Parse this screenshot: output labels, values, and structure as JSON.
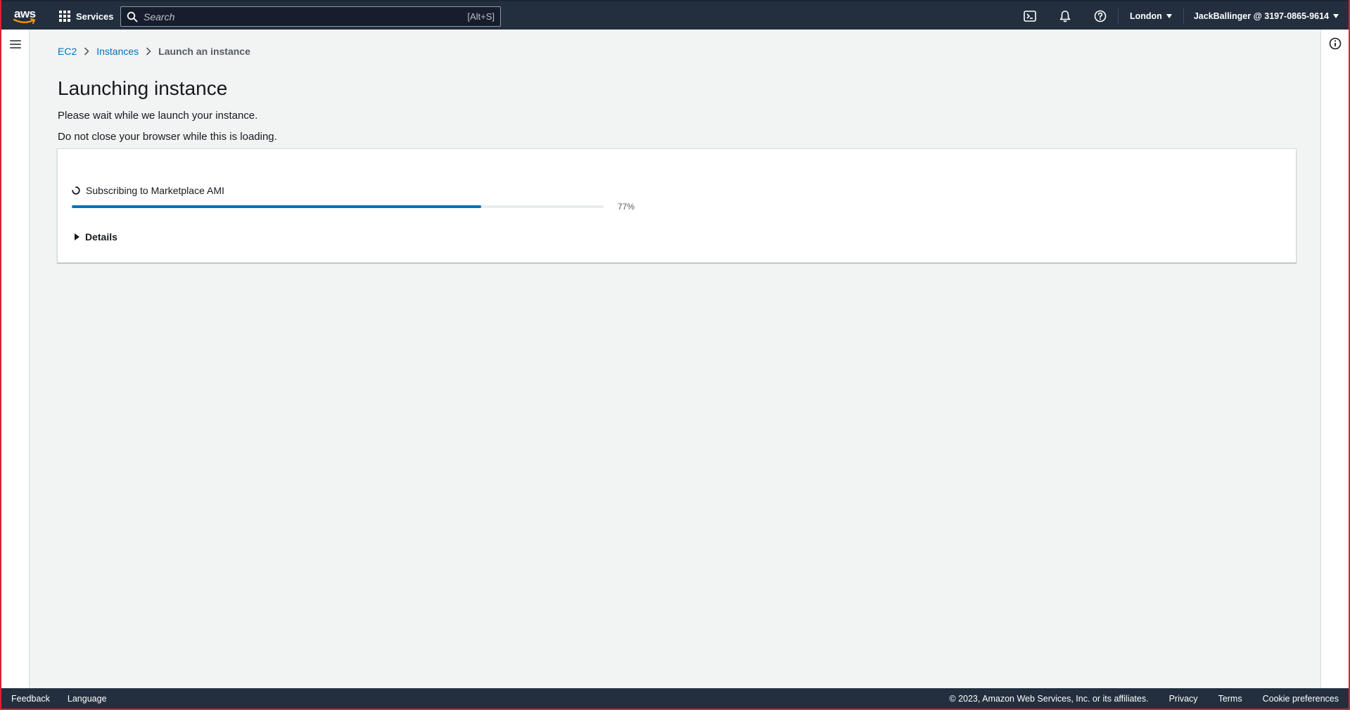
{
  "topnav": {
    "logo_text": "aws",
    "services_label": "Services",
    "search_placeholder": "Search",
    "search_shortcut": "[Alt+S]",
    "region_label": "London",
    "account_label": "JackBallinger @ 3197-0865-9614"
  },
  "breadcrumb": {
    "items": [
      "EC2",
      "Instances"
    ],
    "current": "Launch an instance"
  },
  "page": {
    "title": "Launching instance",
    "desc1": "Please wait while we launch your instance.",
    "desc2": "Do not close your browser while this is loading."
  },
  "progress": {
    "status": "Subscribing to Marketplace AMI",
    "percent": 77,
    "percent_label": "77%",
    "details_label": "Details"
  },
  "footer": {
    "feedback": "Feedback",
    "language": "Language",
    "copyright": "© 2023, Amazon Web Services, Inc. or its affiliates.",
    "privacy": "Privacy",
    "terms": "Terms",
    "cookies": "Cookie preferences"
  },
  "colors": {
    "nav_bg": "#232f3e",
    "link": "#0073bb",
    "progress_fill": "#0073bb",
    "aws_smile": "#ff9900"
  }
}
